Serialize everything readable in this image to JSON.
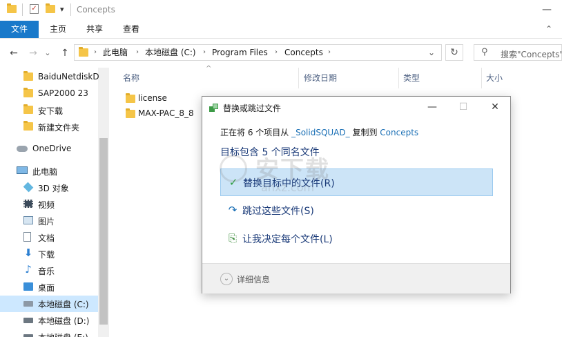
{
  "window": {
    "title": "Concepts",
    "min_glyph": "—",
    "dropdown_glyph": "▾"
  },
  "ribbon": {
    "tabs": [
      {
        "label": "文件"
      },
      {
        "label": "主页"
      },
      {
        "label": "共享"
      },
      {
        "label": "查看"
      }
    ],
    "collapse_glyph": "⌃"
  },
  "nav": {
    "back_glyph": "←",
    "forward_glyph": "→",
    "recent_glyph": "⌄",
    "up_glyph": "↑",
    "breadcrumb": [
      "此电脑",
      "本地磁盘 (C:)",
      "Program Files",
      "Concepts"
    ],
    "sep_glyph": "›",
    "dropdown_glyph": "⌄",
    "refresh_glyph": "↻",
    "search_placeholder": "搜索\"Concepts\"",
    "search_glyph": "⚲"
  },
  "navpane": {
    "items": [
      {
        "label": "BaiduNetdiskD",
        "icon": "folder-icon"
      },
      {
        "label": "SAP2000 23",
        "icon": "folder-icon"
      },
      {
        "label": "安下载",
        "icon": "folder-icon"
      },
      {
        "label": "新建文件夹",
        "icon": "folder-icon"
      },
      {
        "label": "OneDrive",
        "icon": "cloud-icon"
      },
      {
        "label": "此电脑",
        "icon": "computer-icon"
      },
      {
        "label": "3D 对象",
        "icon": "cube-icon"
      },
      {
        "label": "视频",
        "icon": "video-icon"
      },
      {
        "label": "图片",
        "icon": "picture-icon"
      },
      {
        "label": "文档",
        "icon": "document-icon"
      },
      {
        "label": "下载",
        "icon": "download-icon"
      },
      {
        "label": "音乐",
        "icon": "music-icon"
      },
      {
        "label": "桌面",
        "icon": "desktop-icon"
      },
      {
        "label": "本地磁盘 (C:)",
        "icon": "drive-icon"
      },
      {
        "label": "本地磁盘 (D:)",
        "icon": "drive-icon"
      },
      {
        "label": "本地磁盘 (E:)",
        "icon": "drive-icon"
      }
    ]
  },
  "filelist": {
    "sort_glyph": "^",
    "columns": [
      "名称",
      "修改日期",
      "类型",
      "大小"
    ],
    "files": [
      {
        "name": "license"
      },
      {
        "name": "MAX-PAC_8_8"
      }
    ]
  },
  "dialog": {
    "title": "替换或跳过文件",
    "min_glyph": "—",
    "max_glyph": "☐",
    "close_glyph": "✕",
    "status_prefix": "正在将 6 个项目从 ",
    "status_source": "_SolidSQUAD_",
    "status_mid": " 复制到 ",
    "status_dest": "Concepts",
    "heading": "目标包含 5 个同名文件",
    "options": [
      {
        "label": "替换目标中的文件(R)",
        "glyph": "✓",
        "color": "#2a9d3c"
      },
      {
        "label": "跳过这些文件(S)",
        "glyph": "↷",
        "color": "#1a6fb5"
      },
      {
        "label": "让我决定每个文件(L)",
        "glyph": "⎘",
        "color": "#3d8c3d"
      }
    ],
    "details_glyph": "⌄",
    "details_label": "详细信息"
  },
  "watermark": {
    "text": "安下载",
    "subtext": "anxz.com"
  },
  "colors": {
    "accent": "#1979ca",
    "selected_option": "#cce4f7",
    "link": "#1a6fb5",
    "heading": "#1a3a78"
  }
}
